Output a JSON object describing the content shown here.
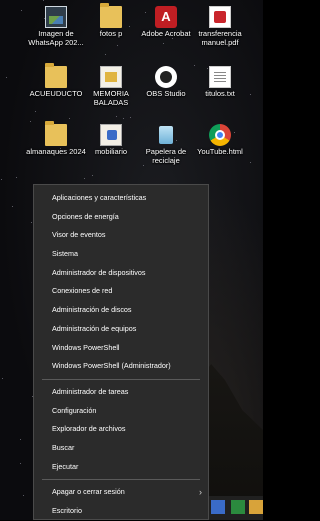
{
  "desktop": {
    "icons": [
      {
        "label": "Imagen de WhatsApp 202...",
        "icon": "image-file-icon",
        "kind": "g-img"
      },
      {
        "label": "fotos p",
        "icon": "folder-icon",
        "kind": "g-folder"
      },
      {
        "label": "Adobe Acrobat",
        "icon": "adobe-acrobat-icon",
        "kind": "g-acrobat"
      },
      {
        "label": "transferencia manuel.pdf",
        "icon": "pdf-file-icon",
        "kind": "g-pdf"
      },
      {
        "label": "ACUEUDUCTO",
        "icon": "folder-icon",
        "kind": "g-folder"
      },
      {
        "label": "MEMORIA BALADAS",
        "icon": "document-icon",
        "kind": "g-doc"
      },
      {
        "label": "OBS Studio",
        "icon": "obs-studio-icon",
        "kind": "g-obs"
      },
      {
        "label": "titulos.txt",
        "icon": "text-file-icon",
        "kind": "g-txt"
      },
      {
        "label": "almanaques 2024",
        "icon": "folder-icon",
        "kind": "g-folder"
      },
      {
        "label": "mobiliario",
        "icon": "word-document-icon",
        "kind": "g-word"
      },
      {
        "label": "Papelera de reciclaje",
        "icon": "recycle-bin-icon",
        "kind": "g-recycle"
      },
      {
        "label": "YouTube.html",
        "icon": "chrome-icon",
        "kind": "g-chrome"
      }
    ]
  },
  "menu": {
    "groups": [
      [
        "Aplicaciones y características",
        "Opciones de energía",
        "Visor de eventos",
        "Sistema",
        "Administrador de dispositivos",
        "Conexiones de red",
        "Administración de discos",
        "Administración de equipos",
        "Windows PowerShell",
        "Windows PowerShell (Administrador)"
      ],
      [
        "Administrador de tareas",
        "Configuración",
        "Explorador de archivos",
        "Buscar",
        "Ejecutar"
      ],
      [
        "Apagar o cerrar sesión",
        "Escritorio"
      ]
    ],
    "submenu_chevron": "›"
  }
}
